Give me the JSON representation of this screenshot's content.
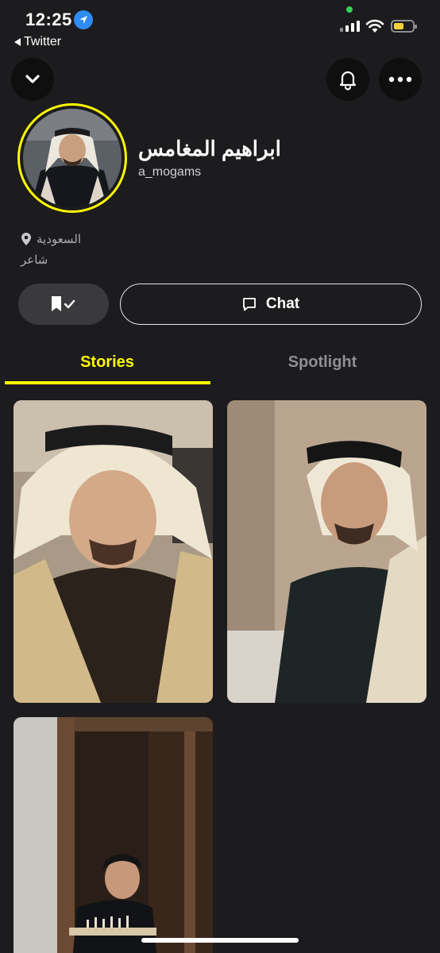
{
  "status_bar": {
    "time": "12:25",
    "back_app": "Twitter"
  },
  "profile": {
    "display_name": "ابراهيم المغامس",
    "username": "a_mogams",
    "location": "السعودية",
    "bio": "شاعر"
  },
  "actions": {
    "chat_label": "Chat"
  },
  "tabs": [
    {
      "label": "Stories",
      "active": true
    },
    {
      "label": "Spotlight",
      "active": false
    }
  ],
  "colors": {
    "accent": "#fffc00",
    "background": "#1c1c1e"
  },
  "icons": {
    "collapse": "chevron-down-icon",
    "notifications": "bell-icon",
    "more": "more-dots-icon",
    "location": "location-pin-icon",
    "saved": "bookmark-check-icon",
    "chat": "chat-bubble-icon"
  }
}
